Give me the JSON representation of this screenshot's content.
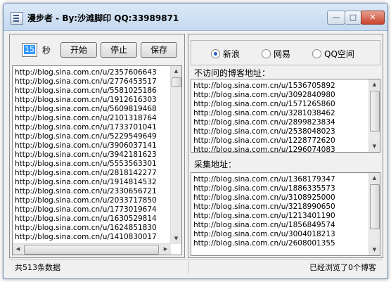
{
  "window": {
    "title": "漫步者 - By:沙滩脚印 QQ:33989871",
    "min_glyph": "—",
    "max_glyph": "□",
    "close_glyph": "✕"
  },
  "controls": {
    "seconds_value": "15",
    "seconds_label": "秒",
    "start_label": "开始",
    "stop_label": "停止",
    "save_label": "保存"
  },
  "main_list": {
    "rows": [
      "http://blog.sina.com.cn/u/2357606643",
      "http://blog.sina.com.cn/u/2776453517",
      "http://blog.sina.com.cn/u/5581025186",
      "http://blog.sina.com.cn/u/1912616303",
      "http://blog.sina.com.cn/u/5609819468",
      "http://blog.sina.com.cn/u/2101318764",
      "http://blog.sina.com.cn/u/1733701041",
      "http://blog.sina.com.cn/u/5229549649",
      "http://blog.sina.com.cn/u/3906037141",
      "http://blog.sina.com.cn/u/3942181623",
      "http://blog.sina.com.cn/u/5553563301",
      "http://blog.sina.com.cn/u/2818142277",
      "http://blog.sina.com.cn/u/1914814532",
      "http://blog.sina.com.cn/u/2330656721",
      "http://blog.sina.com.cn/u/2033717850",
      "http://blog.sina.com.cn/u/1773019674",
      "http://blog.sina.com.cn/u/1630529814",
      "http://blog.sina.com.cn/u/1624851830",
      "http://blog.sina.com.cn/u/1410830017"
    ]
  },
  "radios": [
    {
      "label": "新浪",
      "selected": true
    },
    {
      "label": "网易",
      "selected": false
    },
    {
      "label": "QQ空间",
      "selected": false
    }
  ],
  "exclude_section": {
    "label": "不访问的博客地址：",
    "rows": [
      "http://blog.sina.com.cn/u/1536705892",
      "http://blog.sina.com.cn/u/3092840980",
      "http://blog.sina.com.cn/u/1571265860",
      "http://blog.sina.com.cn/u/3281038462",
      "http://blog.sina.com.cn/u/2899823834",
      "http://blog.sina.com.cn/u/2538048023",
      "http://blog.sina.com.cn/u/1228772620",
      "http://blog.sina.com.cn/u/1296074083"
    ]
  },
  "collect_section": {
    "label": "采集地址：",
    "rows": [
      "http://blog.sina.com.cn/u/1368179347",
      "http://blog.sina.com.cn/u/1886335573",
      "http://blog.sina.com.cn/u/3108925000",
      "http://blog.sina.com.cn/u/3218990650",
      "http://blog.sina.com.cn/u/1213401190",
      "http://blog.sina.com.cn/u/1856849574",
      "http://blog.sina.com.cn/u/3004018213",
      "http://blog.sina.com.cn/u/2608001355"
    ]
  },
  "status": {
    "left": "共513条数据",
    "right": "已经浏览了0个博客"
  }
}
